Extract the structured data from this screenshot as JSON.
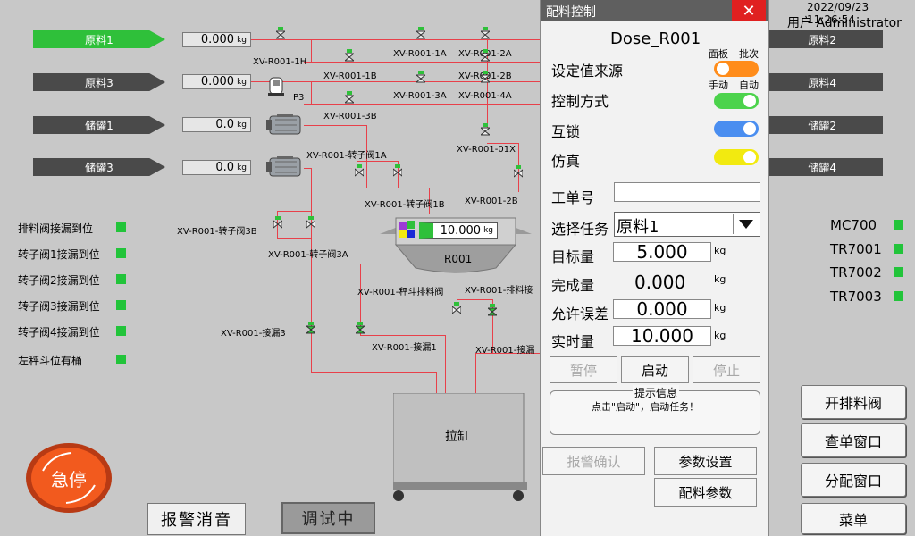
{
  "header": {
    "datetime": "2022/09/23 11:26:54",
    "user": "用户 Administrator"
  },
  "left_tags": [
    {
      "label": "原料1",
      "value": "0.000",
      "unit": "kg",
      "active": true
    },
    {
      "label": "原料3",
      "value": "0.000",
      "unit": "kg",
      "active": false
    },
    {
      "label": "储罐1",
      "value": "0.0",
      "unit": "kg",
      "active": false
    },
    {
      "label": "储罐3",
      "value": "0.0",
      "unit": "kg",
      "active": false
    }
  ],
  "right_tags": [
    "原料2",
    "原料4",
    "储罐2",
    "储罐4"
  ],
  "valves": {
    "xv1h": "XV-R001-1H",
    "xv1a": "XV-R001-1A",
    "xv2a": "XV-R001-2A",
    "xv1b": "XV-R001-1B",
    "xv2b": "XV-R001-2B",
    "p3": "P3",
    "xv3a": "XV-R001-3A",
    "xv4a": "XV-R001-4A",
    "xv3b": "XV-R001-3B",
    "xv01x": "XV-R001-01X",
    "rot1a": "XV-R001-转子阀1A",
    "rot1b": "XV-R001-转子阀1B",
    "rot3b": "XV-R001-转子阀3B",
    "rot3a": "XV-R001-转子阀3A",
    "scale_discharge": "XV-R001-秤斗排料阀",
    "discharge": "XV-R001-排料接",
    "leak3": "XV-R001-接漏3",
    "leak1": "XV-R001-接漏1",
    "leak_r": "XV-R001-接漏"
  },
  "reactor": {
    "name": "R001",
    "value": "10.000",
    "unit": "kg"
  },
  "vat_label": "拉缸",
  "status_left": [
    "排料阀接漏到位",
    "转子阀1接漏到位",
    "转子阀2接漏到位",
    "转子阀3接漏到位",
    "转子阀4接漏到位",
    "左秤斗位有桶"
  ],
  "status_right": [
    "MC700",
    "TR7001",
    "TR7002",
    "TR7003"
  ],
  "emergency": "急停",
  "bottom_buttons": {
    "alarm_mute": "报警消音",
    "debug": "调试中"
  },
  "panel": {
    "title": "配料控制",
    "close": "✕",
    "dose_name": "Dose_R001",
    "setpoint_source": "设定值来源",
    "opt_panel": "面板",
    "opt_batch": "批次",
    "control_mode": "控制方式",
    "opt_manual": "手动",
    "opt_auto": "自动",
    "interlock": "互锁",
    "simulation": "仿真",
    "work_order": "工单号",
    "work_order_value": "",
    "select_task": "选择任务",
    "task_value": "原料1",
    "target_label": "目标量",
    "target_value": "5.000",
    "done_label": "完成量",
    "done_value": "0.000",
    "tolerance_label": "允许误差",
    "tolerance_value": "0.000",
    "actual_label": "实时量",
    "actual_value": "10.000",
    "unit": "kg",
    "pause": "暂停",
    "start": "启动",
    "stop": "停止",
    "info_title": "提示信息",
    "info_text": "点击\"启动\"，启动任务！",
    "alarm_ack": "报警确认",
    "param_set": "参数设置",
    "dose_param": "配料参数"
  },
  "right_buttons": [
    "开排料阀",
    "查单窗口",
    "分配窗口",
    "菜单"
  ],
  "colors": {
    "pipe": "#e8404a",
    "active_green": "#2fc03a",
    "orange": "#ff8c1a",
    "green_toggle": "#4cd34c",
    "blue_toggle": "#4a8ef0",
    "yellow_toggle": "#f2ea10",
    "close_red": "#e02020"
  }
}
